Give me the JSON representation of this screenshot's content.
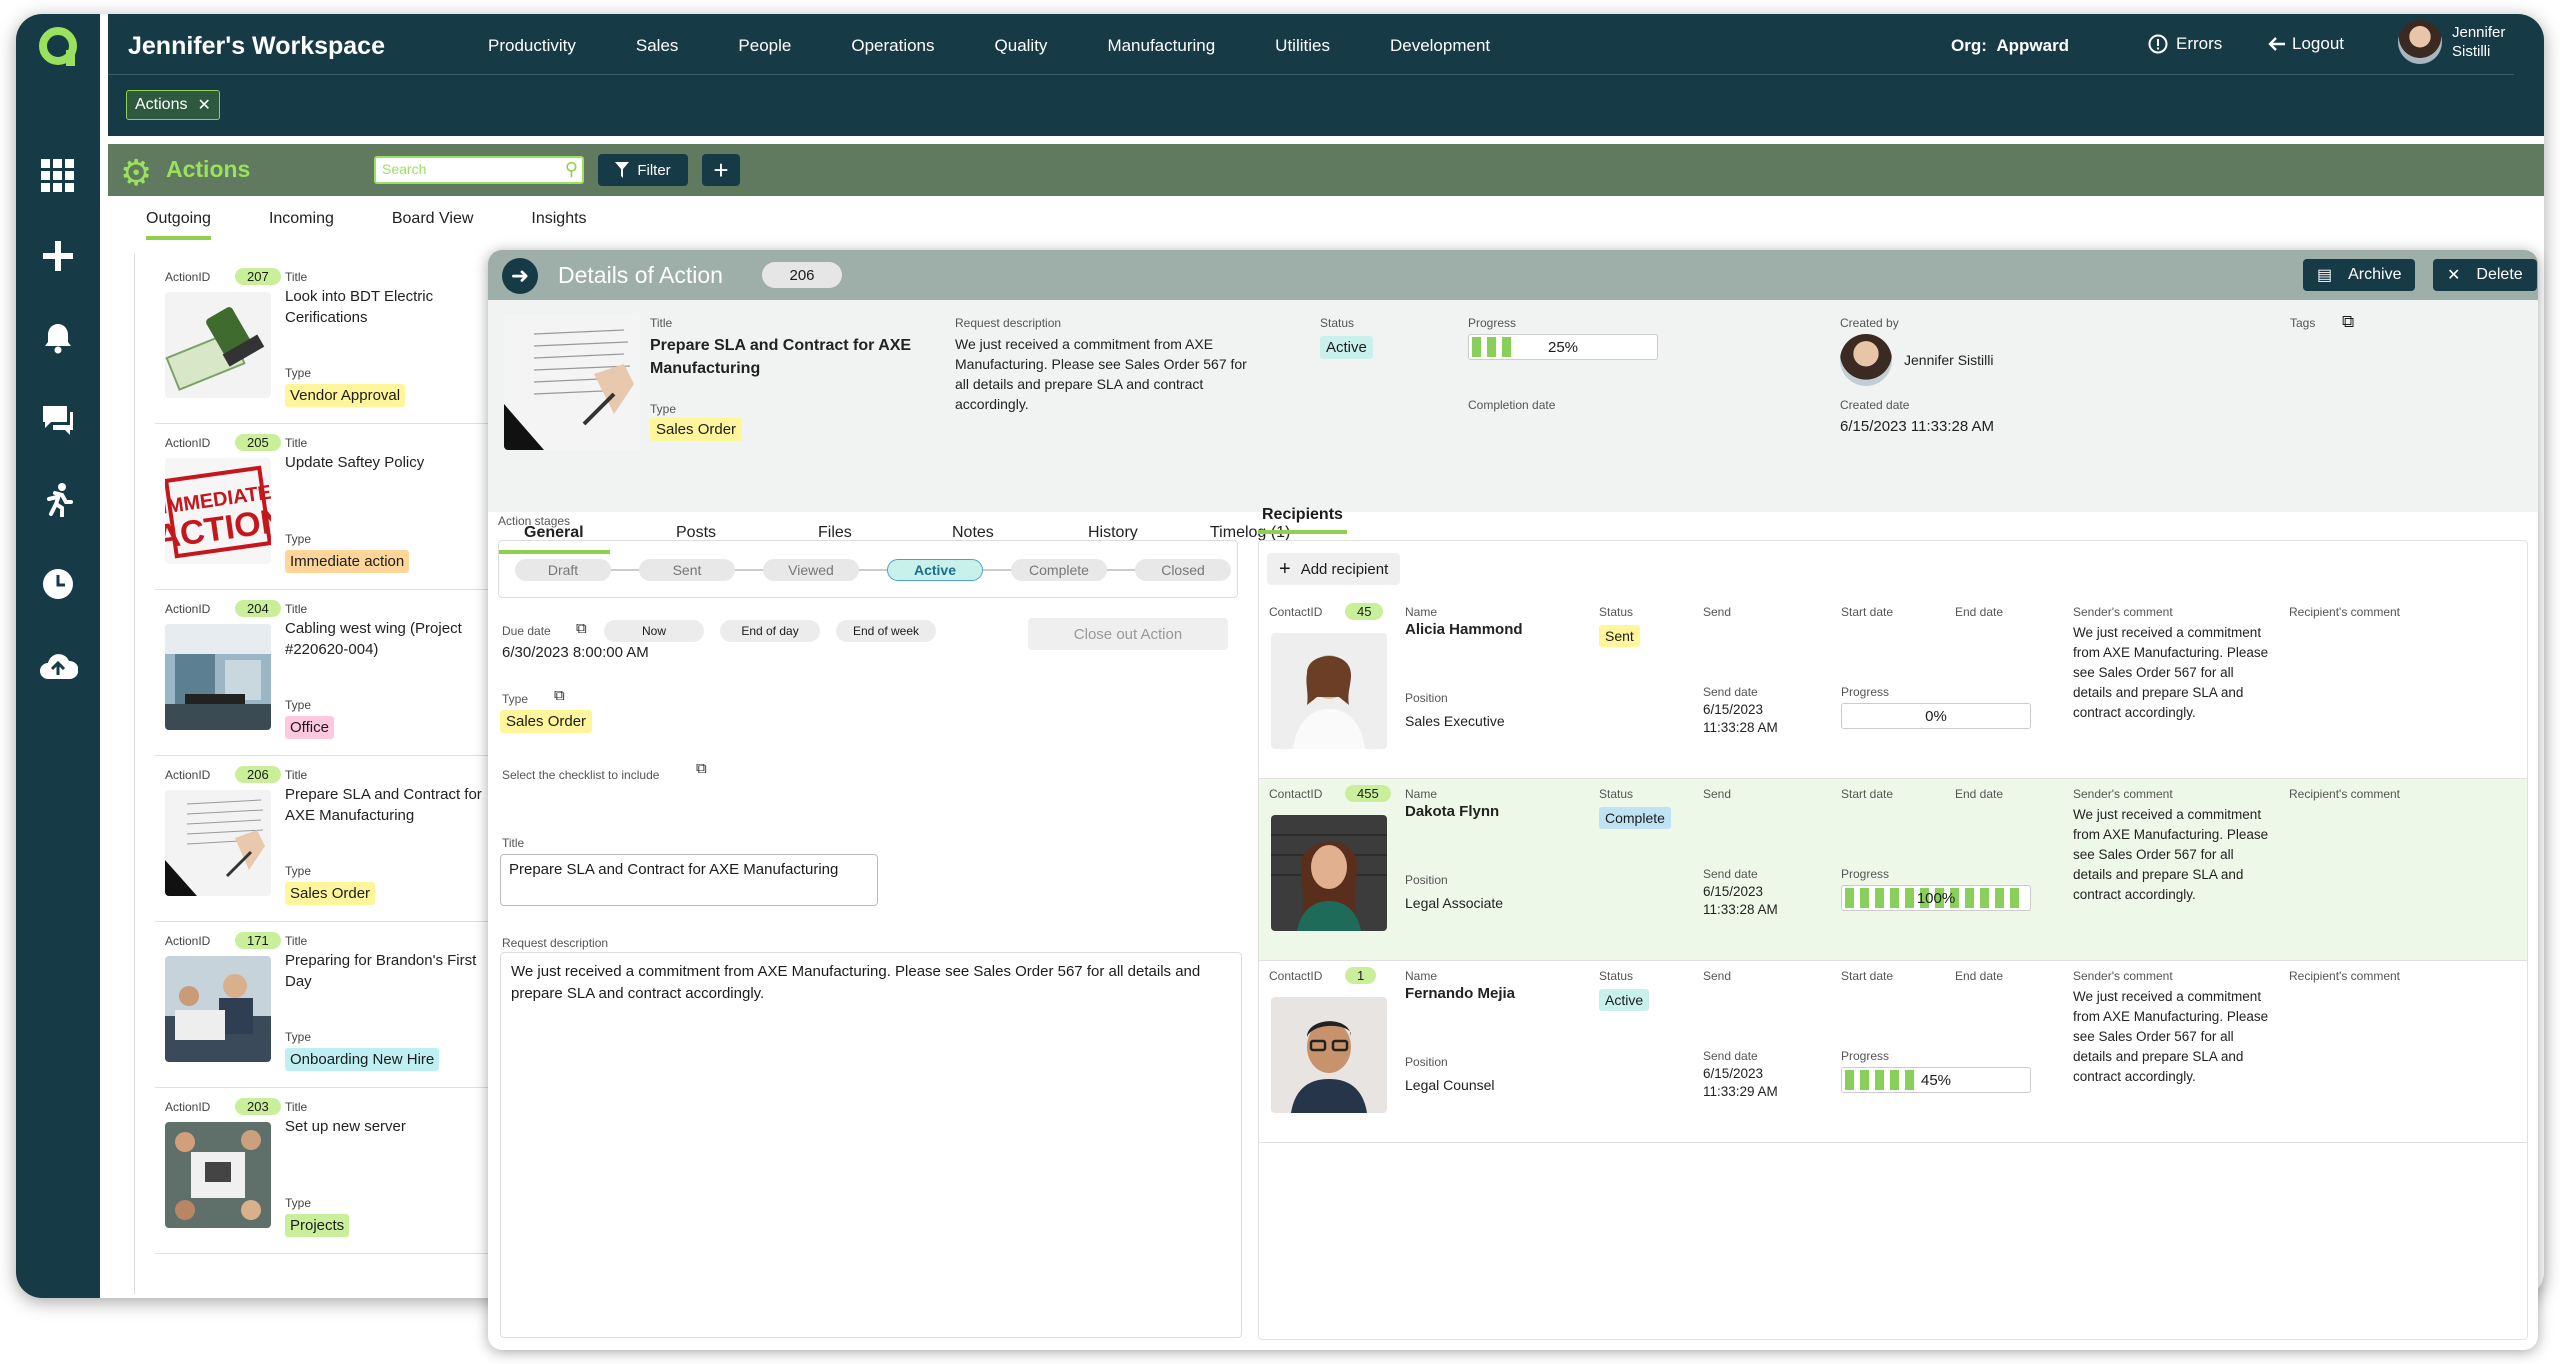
{
  "app": {
    "workspace_title": "Jennifer's Workspace",
    "org_label": "Org:",
    "org_value": "Appward",
    "errors_label": "Errors",
    "logout_label": "Logout",
    "user_first": "Jennifer",
    "user_last": "Sistilli"
  },
  "menu": [
    "Productivity",
    "Sales",
    "People",
    "Operations",
    "Quality",
    "Manufacturing",
    "Utilities",
    "Development"
  ],
  "open_tab": {
    "label": "Actions"
  },
  "module": {
    "title": "Actions",
    "search_placeholder": "Search",
    "filter_label": "Filter"
  },
  "subtabs": [
    "Outgoing",
    "Incoming",
    "Board View",
    "Insights"
  ],
  "cards": [
    {
      "id_label": "ActionID",
      "id": "207",
      "title_label": "Title",
      "title": "Look into BDT Electric Cerifications",
      "type_label": "Type",
      "type": "Vendor Approval",
      "color": "#fff59a"
    },
    {
      "id_label": "ActionID",
      "id": "205",
      "title_label": "Title",
      "title": "Update Saftey Policy",
      "type_label": "Type",
      "type": "Immediate action",
      "color": "#ffd59a"
    },
    {
      "id_label": "ActionID",
      "id": "204",
      "title_label": "Title",
      "title": "Cabling west wing (Project #220620-004)",
      "type_label": "Type",
      "type": "Office",
      "color": "#ffc8de"
    },
    {
      "id_label": "ActionID",
      "id": "206",
      "title_label": "Title",
      "title": "Prepare SLA and Contract for AXE Manufacturing",
      "type_label": "Type",
      "type": "Sales Order",
      "color": "#fff59a"
    },
    {
      "id_label": "ActionID",
      "id": "171",
      "title_label": "Title",
      "title": "Preparing for Brandon's First Day",
      "type_label": "Type",
      "type": "Onboarding New Hire",
      "color": "#bdeff3"
    },
    {
      "id_label": "ActionID",
      "id": "203",
      "title_label": "Title",
      "title": "Set up new server",
      "type_label": "Type",
      "type": "Projects",
      "color": "#c9ef9a"
    }
  ],
  "details": {
    "header": "Details of Action",
    "id": "206",
    "archive_label": "Archive",
    "delete_label": "Delete",
    "title_label": "Title",
    "title": "Prepare SLA and Contract for AXE Manufacturing",
    "type_label": "Type",
    "type": "Sales Order",
    "request_label": "Request description",
    "request": "We just received a commitment from AXE Manufacturing. Please see Sales Order 567 for all details and prepare SLA and contract accordingly.",
    "status_label": "Status",
    "status": "Active",
    "progress_label": "Progress",
    "progress_text": "25%",
    "progress": 0.25,
    "completion_label": "Completion date",
    "created_by_label": "Created by",
    "created_by": "Jennifer Sistilli",
    "created_date_label": "Created date",
    "created_date": "6/15/2023 11:33:28 AM",
    "tags_label": "Tags",
    "tabs": [
      "General",
      "Posts",
      "Files",
      "Notes",
      "History",
      "Timelog (1)"
    ],
    "stages_label": "Action stages",
    "stages": [
      "Draft",
      "Sent",
      "Viewed",
      "Active",
      "Complete",
      "Closed"
    ],
    "due_label": "Due date",
    "due_value": "6/30/2023 8:00:00 AM",
    "due_chips": [
      "Now",
      "End of day",
      "End of week"
    ],
    "close_out": "Close out Action",
    "type2_label": "Type",
    "type2": "Sales Order",
    "checklist_label": "Select the checklist to include",
    "title_field_label": "Title",
    "title_field": "Prepare SLA and Contract for AXE Manufacturing",
    "request_field_label": "Request description",
    "request_field": "We just received a commitment from AXE Manufacturing. Please see Sales Order 567 for all details and prepare SLA and contract accordingly."
  },
  "recipients": {
    "tab": "Recipients",
    "add_label": "Add recipient",
    "cols": {
      "contact": "ContactID",
      "name": "Name",
      "status": "Status",
      "send": "Send",
      "start": "Start date",
      "end": "End date",
      "sender_comment": "Sender's comment",
      "recipient_comment": "Recipient's comment",
      "position": "Position",
      "send_date": "Send date",
      "progress": "Progress"
    },
    "rows": [
      {
        "id": "45",
        "name": "Alicia Hammond",
        "status": "Sent",
        "status_color": "#fff59a",
        "position": "Sales Executive",
        "send_date": "6/15/2023 11:33:28 AM",
        "progress_text": "0%",
        "progress": 0,
        "comment": "We just received a commitment from AXE Manufacturing. Please see Sales Order 567 for all details and prepare SLA and contract accordingly.",
        "highlight": "#ffffff"
      },
      {
        "id": "455",
        "name": "Dakota Flynn",
        "status": "Complete",
        "status_color": "#bfe3f3",
        "position": "Legal Associate",
        "send_date": "6/15/2023 11:33:28 AM",
        "progress_text": "100%",
        "progress": 1,
        "comment": "We just received a commitment from AXE Manufacturing. Please see Sales Order 567 for all details and prepare SLA and contract accordingly.",
        "highlight": "#eef8e8"
      },
      {
        "id": "1",
        "name": "Fernando Mejia",
        "status": "Active",
        "status_color": "#c9f1ec",
        "position": "Legal Counsel",
        "send_date": "6/15/2023 11:33:29 AM",
        "progress_text": "45%",
        "progress": 0.45,
        "comment": "We just received a commitment from AXE Manufacturing. Please see Sales Order 567 for all details and prepare SLA and contract accordingly.",
        "highlight": "#ffffff"
      }
    ]
  }
}
